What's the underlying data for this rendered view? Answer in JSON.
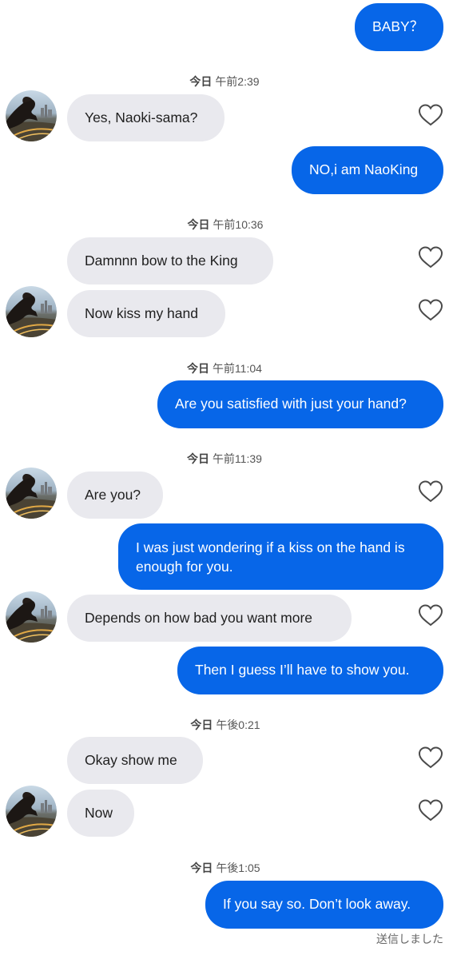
{
  "messages": {
    "m1": "BABY？",
    "m2": "Yes, Naoki-sama?",
    "m3": "NO,i am NaoKing",
    "m4": "Damnnn bow to the King",
    "m5": "Now kiss my hand",
    "m6": "Are you satisfied with just your hand?",
    "m7": "Are you?",
    "m8": "I was just wondering if a kiss on the hand is enough for you.",
    "m9": "Depends on how bad you want more",
    "m10": "Then I guess I’ll have to show you.",
    "m11": "Okay show me",
    "m12": "Now",
    "m13": "If you say so. Don’t look away."
  },
  "timestamps": {
    "day_label": "今日",
    "t1": "午前2:39",
    "t2": "午前10:36",
    "t3": "午前11:04",
    "t4": "午前11:39",
    "t5": "午後0:21",
    "t6": "午後1:05"
  },
  "status": {
    "sent_label": "送信しました"
  },
  "colors": {
    "outgoing_bubble": "#0766e8",
    "incoming_bubble": "#e9e9ee"
  },
  "icons": {
    "like": "heart-outline-icon",
    "avatar": "contact-avatar"
  }
}
